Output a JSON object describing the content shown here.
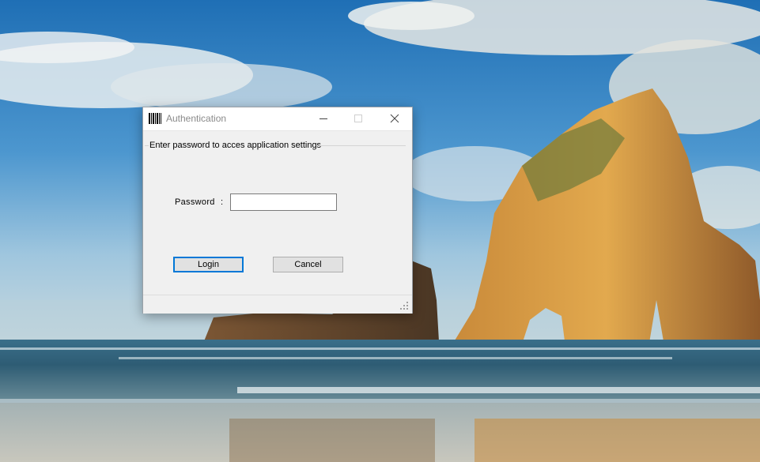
{
  "dialog": {
    "title": "Authentication",
    "group_label": "Enter password to acces application settings",
    "password_label": "Password",
    "password_colon": ":",
    "password_value": "",
    "login_label": "Login",
    "cancel_label": "Cancel"
  },
  "icons": {
    "app": "barcode-icon",
    "minimize": "minimize-icon",
    "maximize": "maximize-icon",
    "close": "close-icon",
    "grip": "resize-grip-icon"
  },
  "colors": {
    "focus_border": "#0078d7",
    "dialog_bg": "#f0f0f0",
    "title_text": "#8a8a8a"
  }
}
